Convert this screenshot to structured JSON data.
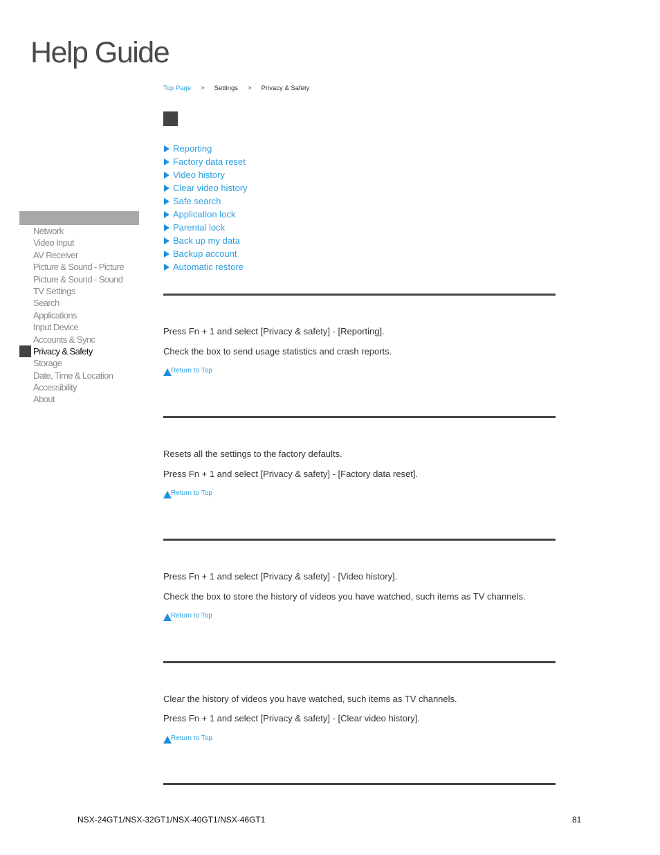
{
  "header": {
    "title": "Help Guide"
  },
  "breadcrumb": {
    "items": [
      {
        "label": "Top Page",
        "link": true
      },
      {
        "label": "Settings",
        "link": false
      },
      {
        "label": "Privacy & Safety",
        "link": false
      }
    ],
    "separator": ">"
  },
  "toc": {
    "items": [
      "Reporting",
      "Factory data reset",
      "Video history",
      "Clear video history",
      "Safe search",
      "Application lock",
      "Parental lock",
      "Back up my data",
      "Backup account",
      "Automatic restore"
    ]
  },
  "sidebar": {
    "items": [
      {
        "label": "Network",
        "active": false
      },
      {
        "label": "Video Input",
        "active": false
      },
      {
        "label": "AV Receiver",
        "active": false
      },
      {
        "label": "Picture & Sound - Picture",
        "active": false
      },
      {
        "label": "Picture & Sound - Sound",
        "active": false
      },
      {
        "label": "TV Settings",
        "active": false
      },
      {
        "label": "Search",
        "active": false
      },
      {
        "label": "Applications",
        "active": false
      },
      {
        "label": "Input Device",
        "active": false
      },
      {
        "label": "Accounts & Sync",
        "active": false
      },
      {
        "label": "Privacy & Safety",
        "active": true
      },
      {
        "label": "Storage",
        "active": false
      },
      {
        "label": "Date, Time & Location",
        "active": false
      },
      {
        "label": "Accessibility",
        "active": false
      },
      {
        "label": "About",
        "active": false
      }
    ]
  },
  "sections": [
    {
      "name": "reporting",
      "paragraphs": [
        "Press Fn + 1 and select [Privacy & safety] - [Reporting].",
        "Check the box to send usage statistics and crash reports."
      ],
      "return_label": "Return to Top"
    },
    {
      "name": "factory-data-reset",
      "paragraphs": [
        "Resets all the settings to the factory defaults.",
        "Press Fn + 1 and select [Privacy & safety] - [Factory data reset]."
      ],
      "return_label": "Return to Top"
    },
    {
      "name": "video-history",
      "paragraphs": [
        "Press Fn + 1 and select [Privacy & safety] - [Video history].",
        "Check the box to store the history of videos you have watched, such items as TV channels."
      ],
      "return_label": "Return to Top"
    },
    {
      "name": "clear-video-history",
      "paragraphs": [
        "Clear the history of videos you have watched, such items as TV channels.",
        "Press Fn + 1 and select [Privacy & safety] - [Clear video history]."
      ],
      "return_label": "Return to Top"
    }
  ],
  "footer": {
    "model": "NSX-24GT1/NSX-32GT1/NSX-40GT1/NSX-46GT1",
    "page_number": "81"
  },
  "colors": {
    "link": "#2b9fe0",
    "marker": "#444444",
    "sidebar_header": "#a8a8a8",
    "sidebar_inactive": "#8a8a8a"
  }
}
